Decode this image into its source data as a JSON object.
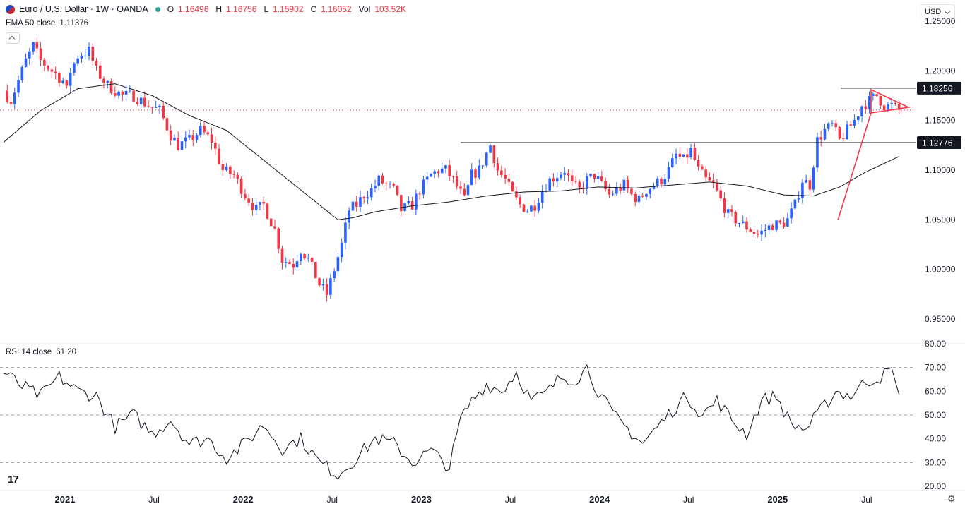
{
  "header": {
    "symbol": "Euro / U.S. Dollar · 1W · OANDA",
    "o_label": "O",
    "o_value": "1.16496",
    "h_label": "H",
    "h_value": "1.16756",
    "l_label": "L",
    "l_value": "1.15902",
    "c_label": "C",
    "c_value": "1.16052",
    "vol_label": "Vol",
    "vol_value": "103.52K"
  },
  "indicators": {
    "ema_label": "EMA 50 close",
    "ema_value": "1.11376",
    "rsi_label": "RSI 14 close",
    "rsi_value": "61.20"
  },
  "currency": "USD",
  "colors": {
    "up": "#2962ff",
    "down": "#f23645",
    "line": "#131722",
    "pattern": "#f23645"
  },
  "chart_data": {
    "type": "candlestick",
    "interval": "weekly",
    "x_axis": {
      "ticks": [
        "2021",
        "Jul",
        "2022",
        "Jul",
        "2023",
        "Jul",
        "2024",
        "Jul",
        "2025",
        "Jul"
      ]
    },
    "price_axis": {
      "ticks": [
        "1.25000",
        "1.20000",
        "1.15000",
        "1.10000",
        "1.05000",
        "1.00000",
        "0.95000"
      ],
      "range": [
        0.925,
        1.255
      ]
    },
    "rsi_axis": {
      "ticks": [
        "80.00",
        "70.00",
        "60.00",
        "50.00",
        "40.00",
        "30.00",
        "20.00"
      ],
      "range": [
        20,
        80
      ],
      "dashed_levels": [
        70,
        50,
        30
      ]
    },
    "horizontal_levels": [
      {
        "label": "1.18256",
        "value": 1.18256
      },
      {
        "label": "1.12776",
        "value": 1.12776
      }
    ],
    "current_price": 1.16052,
    "price_anchors": [
      [
        0,
        1.18
      ],
      [
        2,
        1.17
      ],
      [
        4,
        1.19
      ],
      [
        6,
        1.21
      ],
      [
        8,
        1.225
      ],
      [
        10,
        1.21
      ],
      [
        13,
        1.2
      ],
      [
        16,
        1.19
      ],
      [
        17,
        1.18
      ],
      [
        18,
        1.2
      ],
      [
        20,
        1.215
      ],
      [
        23,
        1.22
      ],
      [
        25,
        1.2
      ],
      [
        28,
        1.185
      ],
      [
        32,
        1.175
      ],
      [
        35,
        1.175
      ],
      [
        39,
        1.165
      ],
      [
        42,
        1.16
      ],
      [
        45,
        1.135
      ],
      [
        47,
        1.125
      ],
      [
        50,
        1.13
      ],
      [
        53,
        1.14
      ],
      [
        56,
        1.13
      ],
      [
        59,
        1.1
      ],
      [
        62,
        1.095
      ],
      [
        65,
        1.075
      ],
      [
        68,
        1.06
      ],
      [
        70,
        1.065
      ],
      [
        73,
        1.04
      ],
      [
        75,
        1.01
      ],
      [
        78,
        1.005
      ],
      [
        80,
        1.02
      ],
      [
        82,
        1.01
      ],
      [
        85,
        0.985
      ],
      [
        87,
        0.975
      ],
      [
        89,
        1.0
      ],
      [
        91,
        1.025
      ],
      [
        93,
        1.06
      ],
      [
        95,
        1.065
      ],
      [
        97,
        1.075
      ],
      [
        99,
        1.08
      ],
      [
        101,
        1.09
      ],
      [
        103,
        1.085
      ],
      [
        105,
        1.08
      ],
      [
        107,
        1.06
      ],
      [
        110,
        1.065
      ],
      [
        112,
        1.08
      ],
      [
        115,
        1.095
      ],
      [
        117,
        1.1
      ],
      [
        119,
        1.1
      ],
      [
        121,
        1.09
      ],
      [
        124,
        1.07
      ],
      [
        126,
        1.095
      ],
      [
        128,
        1.1
      ],
      [
        131,
        1.125
      ],
      [
        133,
        1.1
      ],
      [
        135,
        1.09
      ],
      [
        137,
        1.075
      ],
      [
        139,
        1.065
      ],
      [
        141,
        1.06
      ],
      [
        143,
        1.065
      ],
      [
        145,
        1.08
      ],
      [
        147,
        1.09
      ],
      [
        149,
        1.095
      ],
      [
        151,
        1.1
      ],
      [
        153,
        1.085
      ],
      [
        155,
        1.08
      ],
      [
        157,
        1.09
      ],
      [
        159,
        1.095
      ],
      [
        161,
        1.085
      ],
      [
        163,
        1.075
      ],
      [
        165,
        1.08
      ],
      [
        167,
        1.085
      ],
      [
        169,
        1.075
      ],
      [
        171,
        1.07
      ],
      [
        173,
        1.08
      ],
      [
        175,
        1.085
      ],
      [
        177,
        1.09
      ],
      [
        179,
        1.1
      ],
      [
        181,
        1.115
      ],
      [
        183,
        1.11
      ],
      [
        185,
        1.12
      ],
      [
        187,
        1.1
      ],
      [
        189,
        1.09
      ],
      [
        191,
        1.085
      ],
      [
        193,
        1.07
      ],
      [
        195,
        1.055
      ],
      [
        197,
        1.05
      ],
      [
        199,
        1.045
      ],
      [
        201,
        1.04
      ],
      [
        203,
        1.035
      ],
      [
        205,
        1.04
      ],
      [
        207,
        1.045
      ],
      [
        209,
        1.045
      ],
      [
        211,
        1.05
      ],
      [
        213,
        1.065
      ],
      [
        215,
        1.09
      ],
      [
        217,
        1.085
      ],
      [
        219,
        1.13
      ],
      [
        221,
        1.14
      ],
      [
        223,
        1.145
      ],
      [
        225,
        1.13
      ],
      [
        227,
        1.14
      ],
      [
        229,
        1.15
      ],
      [
        231,
        1.165
      ],
      [
        233,
        1.17
      ],
      [
        235,
        1.175
      ],
      [
        237,
        1.165
      ],
      [
        239,
        1.165
      ],
      [
        241,
        1.16
      ]
    ],
    "ema_anchors": [
      [
        0,
        1.128
      ],
      [
        10,
        1.16
      ],
      [
        20,
        1.182
      ],
      [
        30,
        1.187
      ],
      [
        40,
        1.175
      ],
      [
        50,
        1.155
      ],
      [
        60,
        1.14
      ],
      [
        70,
        1.11
      ],
      [
        80,
        1.08
      ],
      [
        90,
        1.05
      ],
      [
        94,
        1.052
      ],
      [
        100,
        1.058
      ],
      [
        110,
        1.064
      ],
      [
        120,
        1.068
      ],
      [
        130,
        1.074
      ],
      [
        140,
        1.078
      ],
      [
        150,
        1.079
      ],
      [
        160,
        1.083
      ],
      [
        170,
        1.082
      ],
      [
        180,
        1.085
      ],
      [
        190,
        1.088
      ],
      [
        200,
        1.084
      ],
      [
        210,
        1.075
      ],
      [
        218,
        1.074
      ],
      [
        225,
        1.083
      ],
      [
        232,
        1.098
      ],
      [
        241,
        1.11376
      ]
    ],
    "rsi_anchors": [
      [
        0,
        68
      ],
      [
        5,
        62
      ],
      [
        10,
        58
      ],
      [
        15,
        66
      ],
      [
        20,
        60
      ],
      [
        25,
        58
      ],
      [
        30,
        45
      ],
      [
        35,
        50
      ],
      [
        40,
        42
      ],
      [
        45,
        48
      ],
      [
        50,
        38
      ],
      [
        55,
        40
      ],
      [
        60,
        32
      ],
      [
        65,
        38
      ],
      [
        70,
        46
      ],
      [
        75,
        36
      ],
      [
        80,
        40
      ],
      [
        85,
        30
      ],
      [
        90,
        25
      ],
      [
        95,
        32
      ],
      [
        100,
        40
      ],
      [
        105,
        38
      ],
      [
        110,
        30
      ],
      [
        115,
        35
      ],
      [
        120,
        28
      ],
      [
        123,
        48
      ],
      [
        126,
        56
      ],
      [
        130,
        63
      ],
      [
        134,
        60
      ],
      [
        138,
        68
      ],
      [
        142,
        56
      ],
      [
        146,
        59
      ],
      [
        150,
        66
      ],
      [
        154,
        65
      ],
      [
        157,
        70
      ],
      [
        160,
        60
      ],
      [
        164,
        50
      ],
      [
        168,
        44
      ],
      [
        172,
        38
      ],
      [
        176,
        45
      ],
      [
        180,
        52
      ],
      [
        184,
        58
      ],
      [
        188,
        50
      ],
      [
        192,
        56
      ],
      [
        196,
        48
      ],
      [
        200,
        42
      ],
      [
        204,
        56
      ],
      [
        208,
        58
      ],
      [
        212,
        46
      ],
      [
        216,
        44
      ],
      [
        220,
        52
      ],
      [
        224,
        60
      ],
      [
        228,
        58
      ],
      [
        232,
        64
      ],
      [
        236,
        66
      ],
      [
        239,
        69
      ],
      [
        240,
        62
      ],
      [
        241,
        61.2
      ]
    ]
  }
}
